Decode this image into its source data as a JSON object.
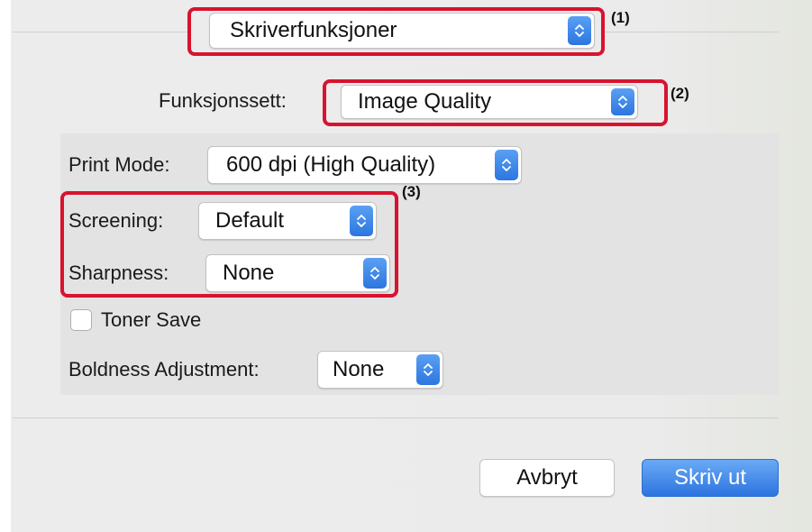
{
  "menu_popup": {
    "value": "Skriverfunksjoner"
  },
  "feature_set": {
    "label": "Funksjonssett:",
    "value": "Image Quality"
  },
  "print_mode": {
    "label": "Print Mode:",
    "value": "600 dpi (High Quality)"
  },
  "screening": {
    "label": "Screening:",
    "value": "Default"
  },
  "sharpness": {
    "label": "Sharpness:",
    "value": "None"
  },
  "toner_save": {
    "label": "Toner Save",
    "checked": false
  },
  "boldness": {
    "label": "Boldness Adjustment:",
    "value": "None"
  },
  "callouts": [
    "(1)",
    "(2)",
    "(3)"
  ],
  "buttons": {
    "cancel": "Avbryt",
    "print": "Skriv ut"
  },
  "colors": {
    "accent": "#2c76df",
    "highlight": "#d8132f"
  },
  "icons": {
    "stepper": "up-down-chevron-icon"
  }
}
